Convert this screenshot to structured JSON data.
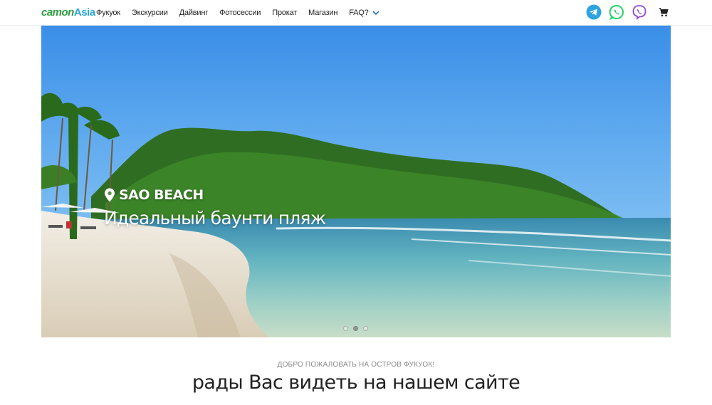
{
  "logo": {
    "part1": "camon",
    "part2": "Asia"
  },
  "nav": {
    "items": [
      {
        "label": "Фукуок"
      },
      {
        "label": "Экскурсии"
      },
      {
        "label": "Дайвинг"
      },
      {
        "label": "Фотосессии"
      },
      {
        "label": "Прокат"
      },
      {
        "label": "Магазин"
      },
      {
        "label": "FAQ?"
      }
    ]
  },
  "social": {
    "telegram": {
      "icon": "telegram-icon",
      "color": "#2fa3e0"
    },
    "whatsapp": {
      "icon": "whatsapp-icon",
      "color": "#25d366"
    },
    "viber": {
      "icon": "viber-icon",
      "color": "#8f4ad6"
    },
    "cart": {
      "icon": "cart-icon",
      "color": "#222222"
    }
  },
  "hero": {
    "location": "SAO BEACH",
    "subtitle": "Идеальный баунти пляж",
    "slides_count": 3,
    "active_slide": 2
  },
  "welcome": {
    "overline": "ДОБРО ПОЖАЛОВАТЬ НА ОСТРОВ ФУКУОК!",
    "title": "рады Вас видеть на нашем сайте"
  }
}
